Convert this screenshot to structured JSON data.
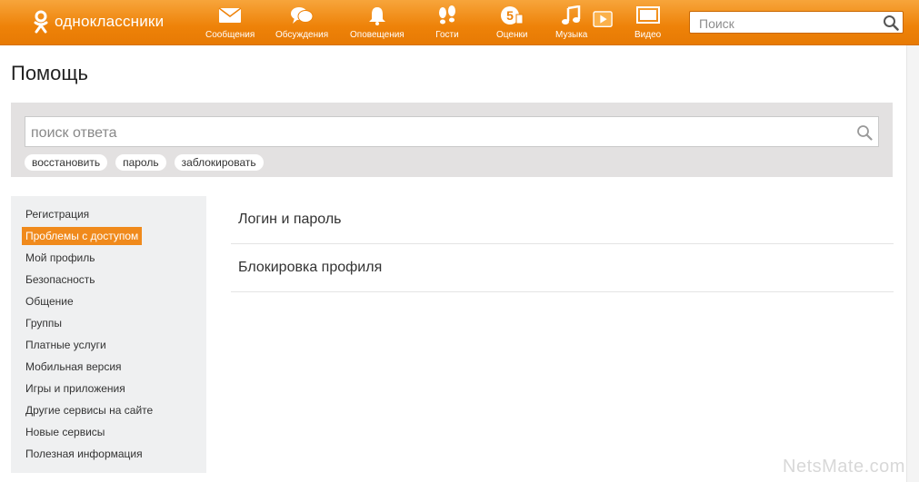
{
  "header": {
    "logo_text": "одноклассники",
    "nav": [
      {
        "label": "Сообщения",
        "icon": "envelope-icon"
      },
      {
        "label": "Обсуждения",
        "icon": "speech-bubbles-icon"
      },
      {
        "label": "Оповещения",
        "icon": "bell-icon"
      },
      {
        "label": "Гости",
        "icon": "footprints-icon"
      },
      {
        "label": "Оценки",
        "icon": "rating-five-icon"
      },
      {
        "label": "Музыка",
        "icon": "music-note-icon"
      },
      {
        "label": "Видео",
        "icon": "video-icon"
      }
    ],
    "search_placeholder": "Поиск"
  },
  "page": {
    "title": "Помощь",
    "search": {
      "placeholder": "поиск ответа",
      "chips": [
        "восстановить",
        "пароль",
        "заблокировать"
      ]
    },
    "sidebar": {
      "items": [
        {
          "label": "Регистрация",
          "active": false
        },
        {
          "label": "Проблемы с доступом",
          "active": true
        },
        {
          "label": "Мой профиль",
          "active": false
        },
        {
          "label": "Безопасность",
          "active": false
        },
        {
          "label": "Общение",
          "active": false
        },
        {
          "label": "Группы",
          "active": false
        },
        {
          "label": "Платные услуги",
          "active": false
        },
        {
          "label": "Мобильная версия",
          "active": false
        },
        {
          "label": "Игры и приложения",
          "active": false
        },
        {
          "label": "Другие сервисы на сайте",
          "active": false
        },
        {
          "label": "Новые сервисы",
          "active": false
        },
        {
          "label": "Полезная информация",
          "active": false
        }
      ]
    },
    "content": {
      "items": [
        "Логин и пароль",
        "Блокировка профиля"
      ]
    }
  },
  "watermark": "NetsMate.com",
  "colors": {
    "brand": "#ee8208",
    "active_item": "#f08a1c"
  }
}
